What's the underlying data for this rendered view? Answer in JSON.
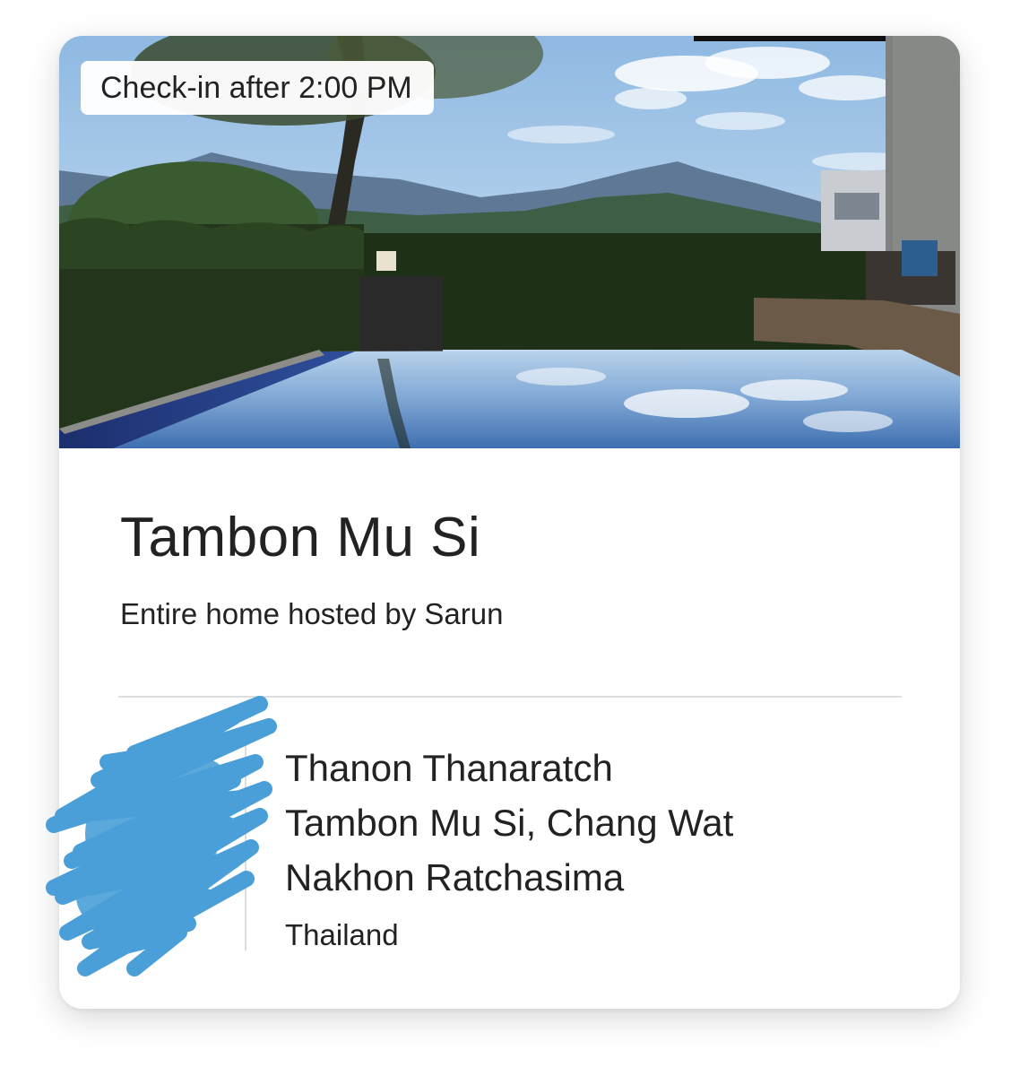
{
  "listing": {
    "checkin_badge": "Check-in after 2:00 PM",
    "title": "Tambon Mu Si",
    "subtitle": "Entire home hosted by Sarun"
  },
  "address": {
    "lines": [
      "Thanon Thanaratch",
      "Tambon Mu Si, Chang Wat",
      "Nakhon Ratchasima"
    ],
    "country": "Thailand"
  },
  "colors": {
    "scribble": "#4a9fd8",
    "divider": "#dddddd",
    "text": "#222222"
  }
}
